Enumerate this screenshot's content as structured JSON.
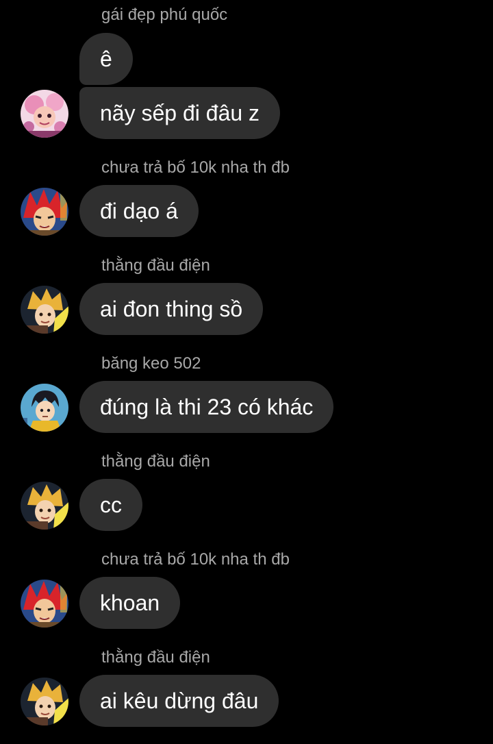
{
  "messages": [
    {
      "sender": "gái đẹp phú quốc",
      "texts": [
        "ê",
        "nãy sếp đi đâu z"
      ],
      "avatar": "pink-haired-anime-avatar-icon"
    },
    {
      "sender": "chưa trả bố 10k nha th đb",
      "texts": [
        "đi dạo á"
      ],
      "avatar": "red-haired-anime-avatar-icon"
    },
    {
      "sender": "thằng đầu điện",
      "texts": [
        "ai đon thing sồ"
      ],
      "avatar": "blond-anime-avatar-icon"
    },
    {
      "sender": "băng keo 502",
      "texts": [
        "đúng là thi 23 có khác"
      ],
      "avatar": "dark-haired-anime-avatar-icon"
    },
    {
      "sender": "thằng đầu điện",
      "texts": [
        "cc"
      ],
      "avatar": "blond-anime-avatar-icon"
    },
    {
      "sender": "chưa trả bố 10k nha th đb",
      "texts": [
        "khoan"
      ],
      "avatar": "red-haired-anime-avatar-icon"
    },
    {
      "sender": "thằng đầu điện",
      "texts": [
        "ai kêu dừng đâu"
      ],
      "avatar": "blond-anime-avatar-icon"
    }
  ],
  "colors": {
    "background": "#000000",
    "bubble": "#2f2f2f",
    "message_text": "#ffffff",
    "sender_text": "#a8a8a8"
  }
}
